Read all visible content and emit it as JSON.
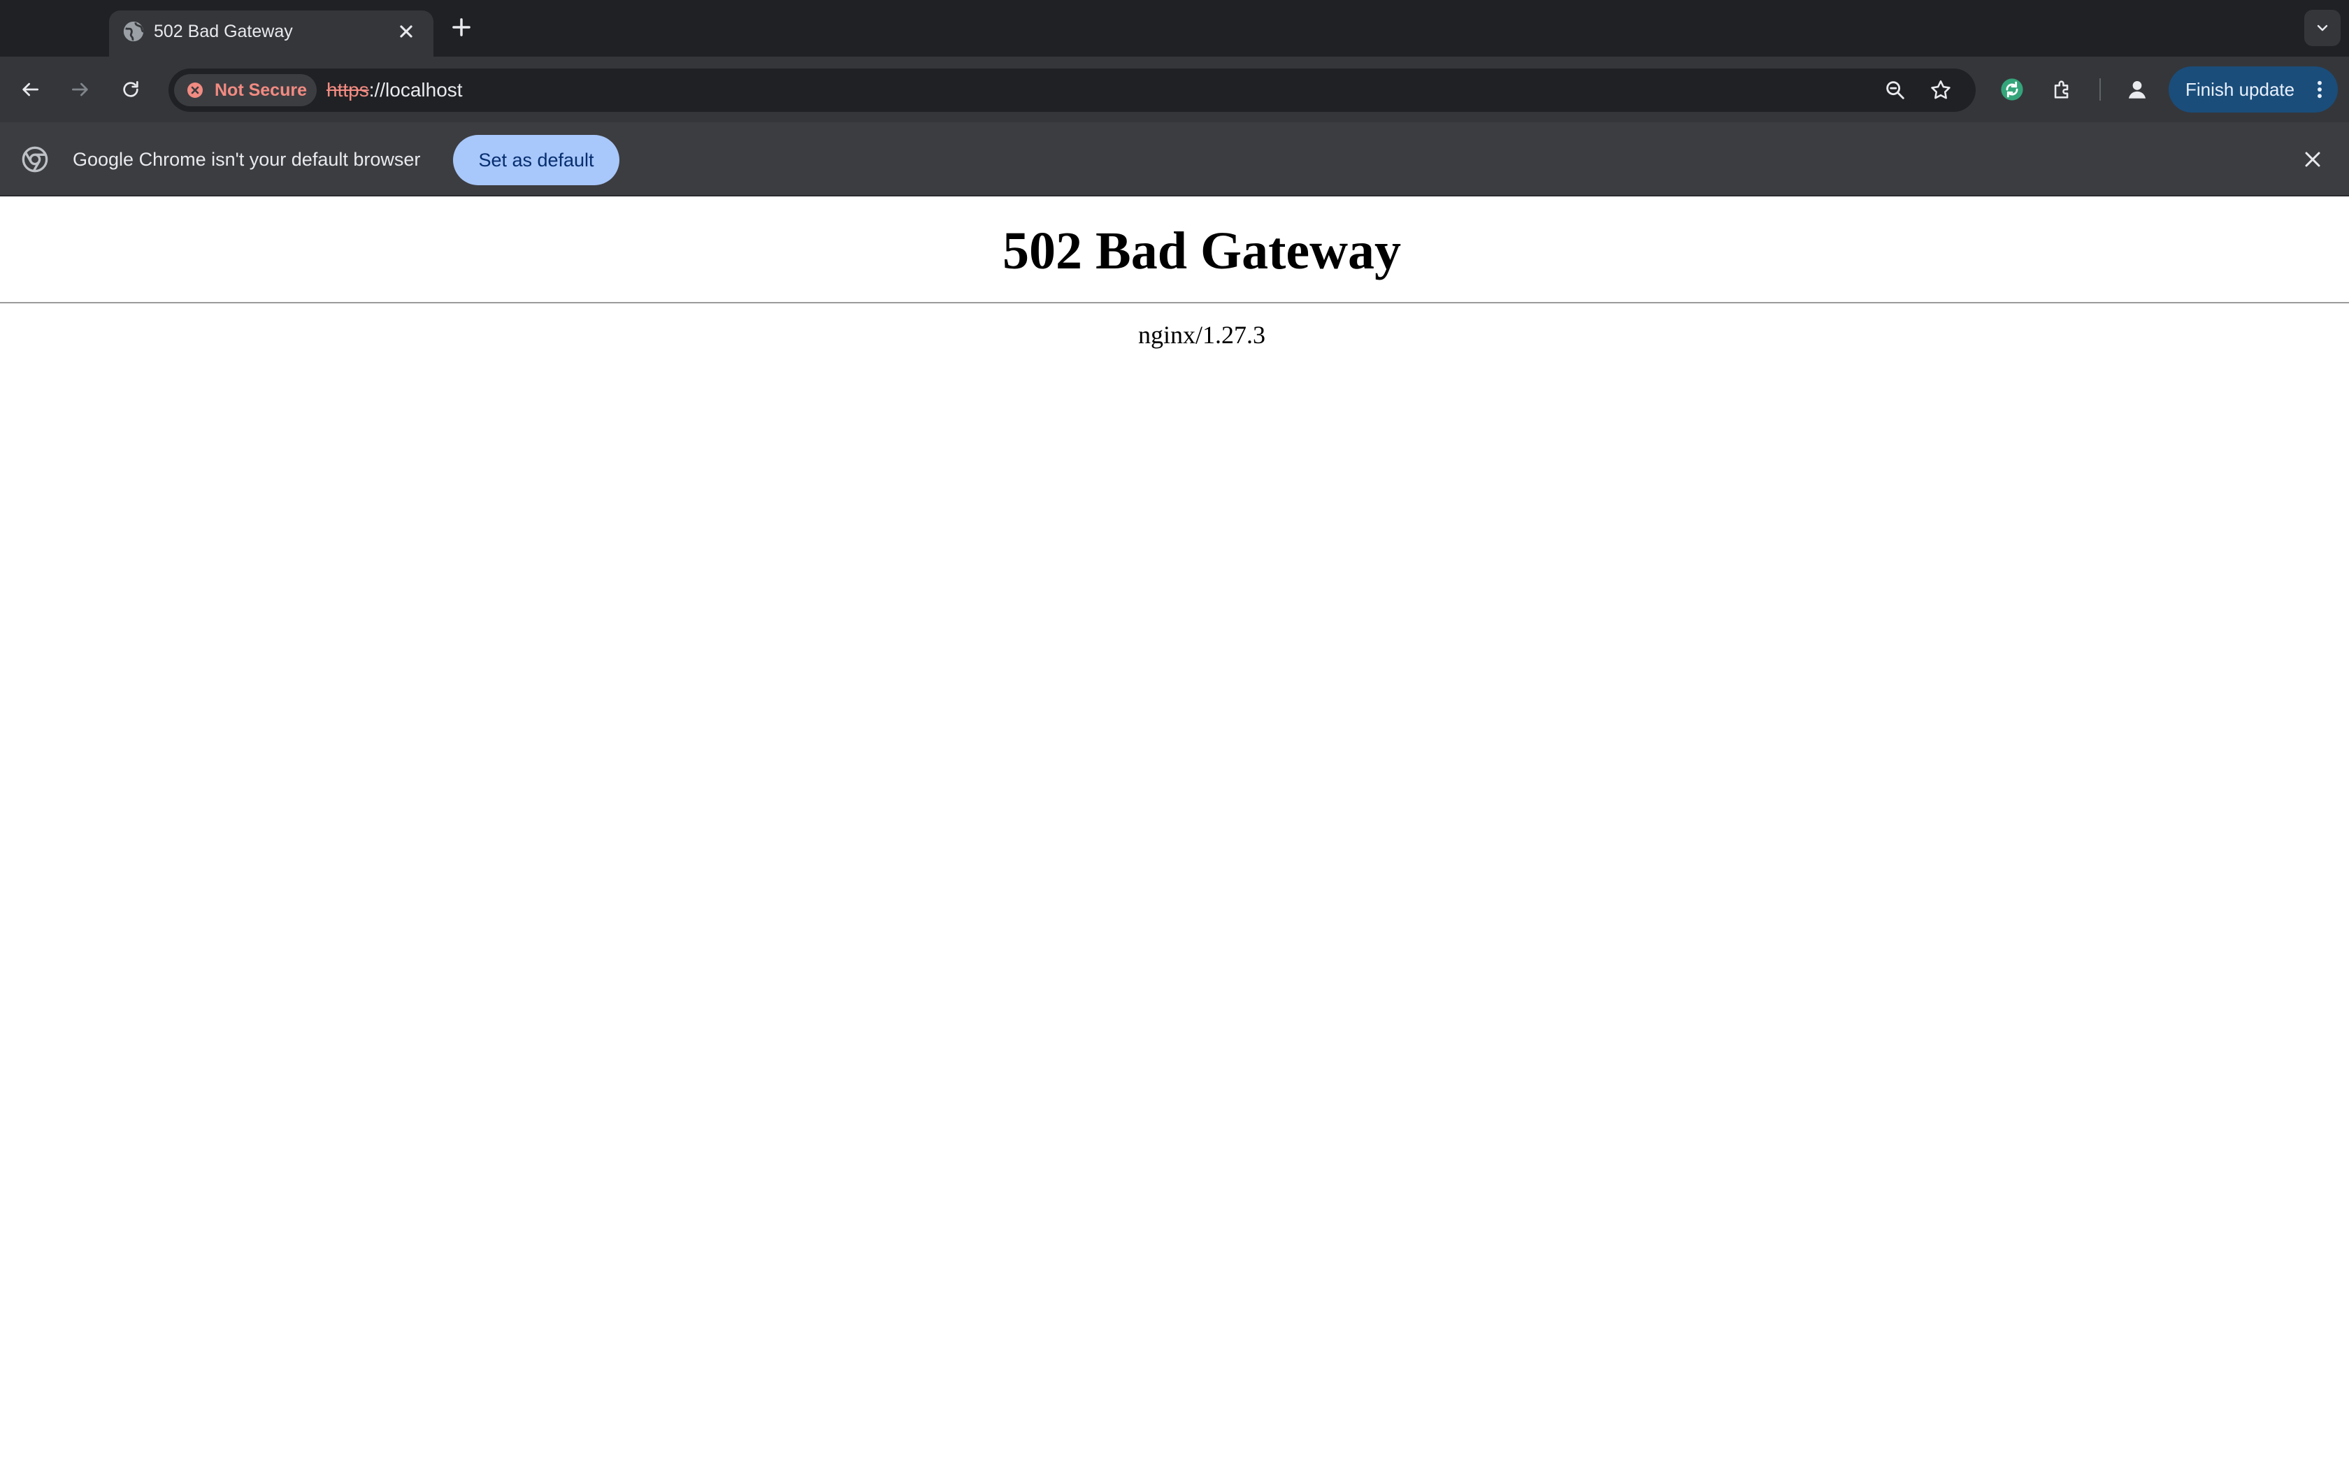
{
  "browser": {
    "tab": {
      "title": "502 Bad Gateway",
      "favicon": "globe-icon"
    },
    "address_bar": {
      "security_chip": "Not Secure",
      "url_scheme": "https",
      "url_rest": "://localhost"
    },
    "finish_update_label": "Finish update",
    "colors": {
      "frame": "#202124",
      "toolbar": "#35363a",
      "insecure": "#f28b82",
      "update_button": "#1a4d7a",
      "set_default_button": "#a8c7fa"
    }
  },
  "infobar": {
    "message": "Google Chrome isn't your default browser",
    "button_label": "Set as default"
  },
  "page": {
    "heading": "502 Bad Gateway",
    "server": "nginx/1.27.3"
  }
}
